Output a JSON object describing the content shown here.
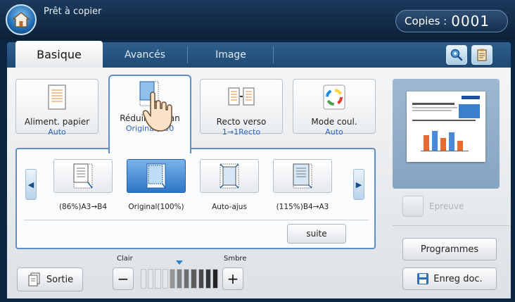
{
  "status": {
    "text": "Prêt à copier"
  },
  "copies": {
    "label": "Copies :",
    "value": "0001"
  },
  "tabs": [
    {
      "label": "Basique",
      "active": true
    },
    {
      "label": "Avancés",
      "active": false
    },
    {
      "label": "Image",
      "active": false
    }
  ],
  "functions": [
    {
      "name": "Aliment. papier",
      "value": "Auto"
    },
    {
      "name": "Réduire/Agran",
      "value": "Original(100"
    },
    {
      "name": "Recto verso",
      "value": "1→1Recto"
    },
    {
      "name": "Mode coul.",
      "value": "Auto"
    }
  ],
  "reduce_options": [
    {
      "label": "(86%)A3→B4",
      "selected": false
    },
    {
      "label": "Original(100%)",
      "selected": true
    },
    {
      "label": "Auto-ajus",
      "selected": false
    },
    {
      "label": "(115%)B4→A3",
      "selected": false
    }
  ],
  "suite_label": "suite",
  "output": {
    "label": "Sortie"
  },
  "density": {
    "light_label": "Clair",
    "dark_label": "Smbre",
    "minus": "−",
    "plus": "+",
    "level": 4,
    "steps": 11
  },
  "proof": {
    "label": "Epreuve"
  },
  "programs": {
    "label": "Programmes"
  },
  "save_doc": {
    "label": "Enreg doc."
  },
  "colors": {
    "accent": "#2c63c6",
    "tabbar": "#2f5f8c",
    "selected": "#2d77c8"
  }
}
